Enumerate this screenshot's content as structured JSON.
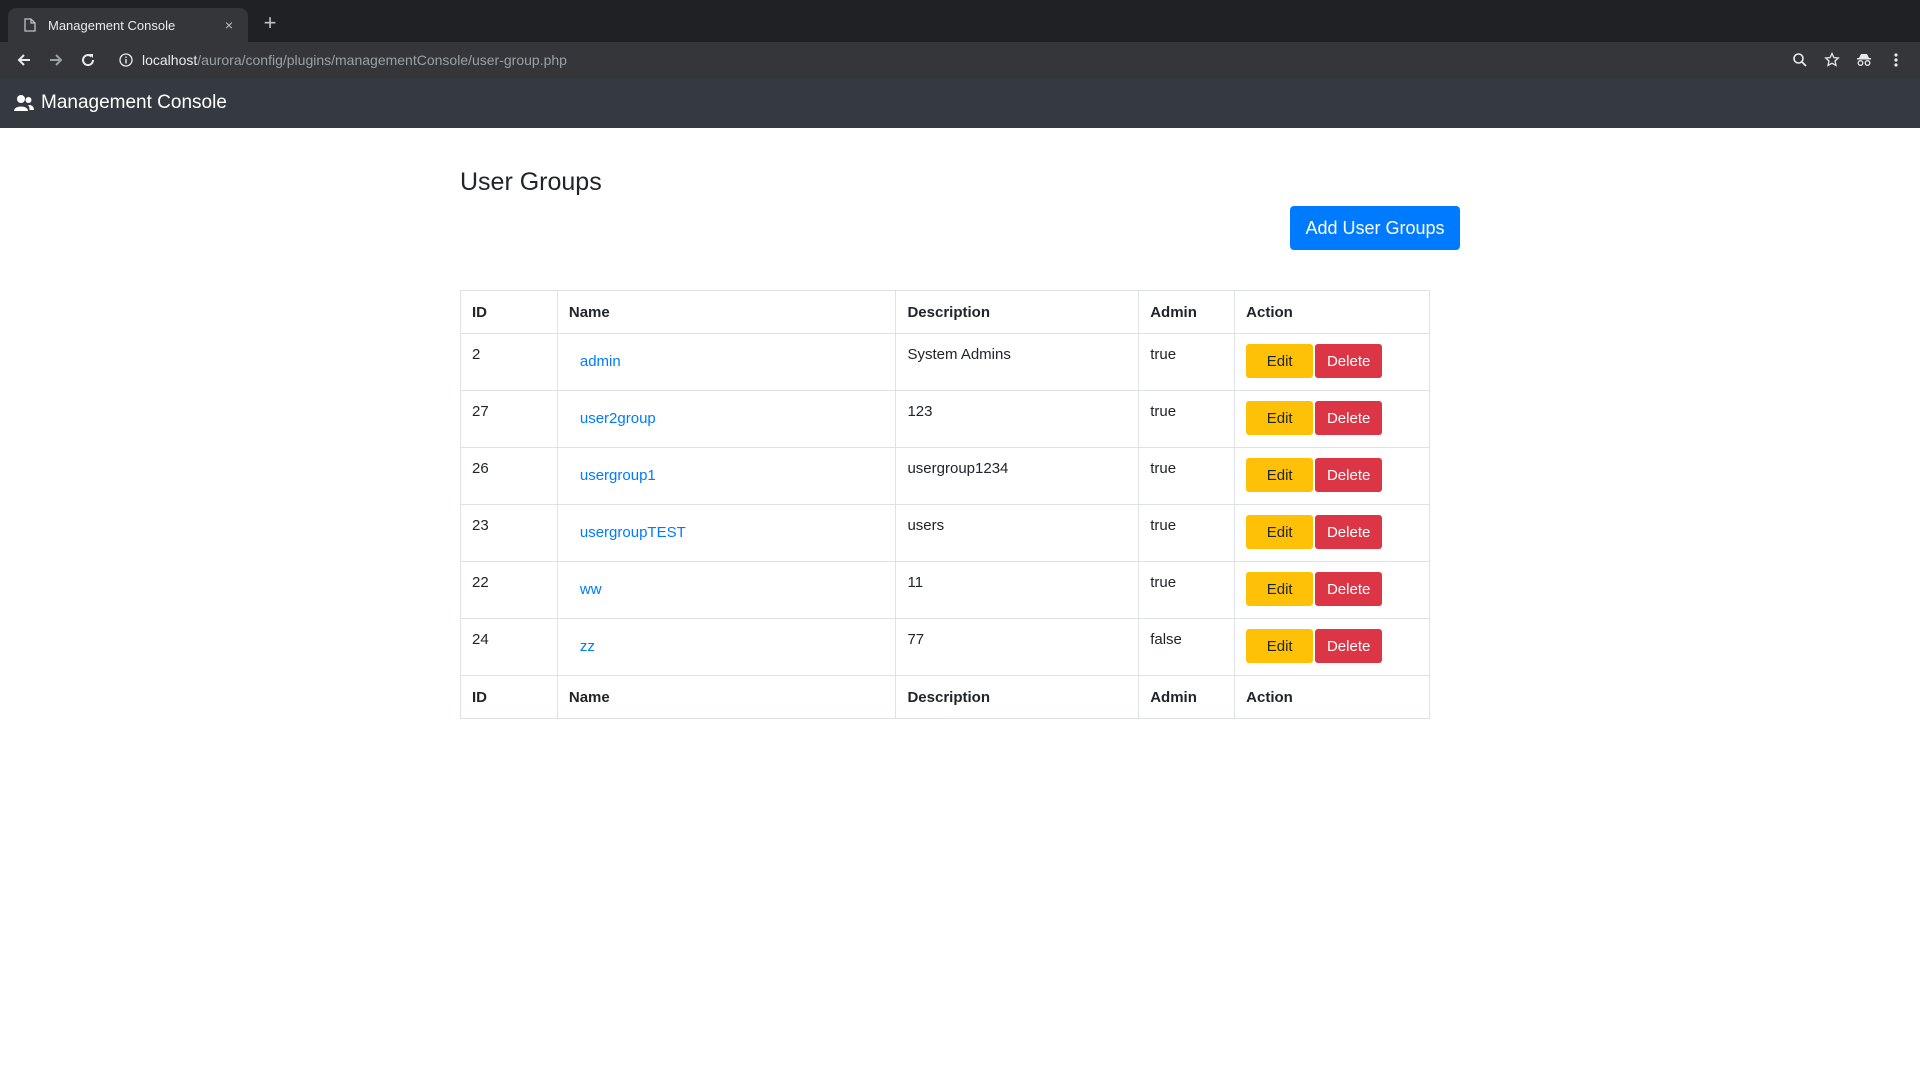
{
  "browser": {
    "tab_title": "Management Console",
    "tab_close": "×",
    "new_tab": "+",
    "url_host": "localhost",
    "url_path": "/aurora/config/plugins/managementConsole/user-group.php"
  },
  "navbar": {
    "brand": "Management Console"
  },
  "page": {
    "title": "User Groups",
    "add_button": "Add User Groups"
  },
  "table": {
    "headers": {
      "id": "ID",
      "name": "Name",
      "description": "Description",
      "admin": "Admin",
      "action": "Action"
    },
    "rows": [
      {
        "id": "2",
        "name": "admin",
        "description": "System Admins",
        "admin": "true"
      },
      {
        "id": "27",
        "name": "user2group",
        "description": "123",
        "admin": "true"
      },
      {
        "id": "26",
        "name": "usergroup1",
        "description": "usergroup1234",
        "admin": "true"
      },
      {
        "id": "23",
        "name": "usergroupTEST",
        "description": "users",
        "admin": "true"
      },
      {
        "id": "22",
        "name": "ww",
        "description": "11",
        "admin": "true"
      },
      {
        "id": "24",
        "name": "zz",
        "description": "77",
        "admin": "false"
      }
    ],
    "edit_label": "Edit",
    "delete_label": "Delete"
  },
  "colors": {
    "navbar": "#343a40",
    "primary": "#007bff",
    "warning": "#ffc107",
    "danger": "#dc3545"
  },
  "icons": {
    "tab": "page-icon",
    "back": "arrow-left-icon",
    "forward": "arrow-right-icon",
    "reload": "reload-icon",
    "site_info": "info-icon",
    "zoom": "zoom-icon",
    "bookmark": "star-icon",
    "incognito": "incognito-icon",
    "menu": "kebab-menu-icon",
    "brand": "users-icon"
  }
}
